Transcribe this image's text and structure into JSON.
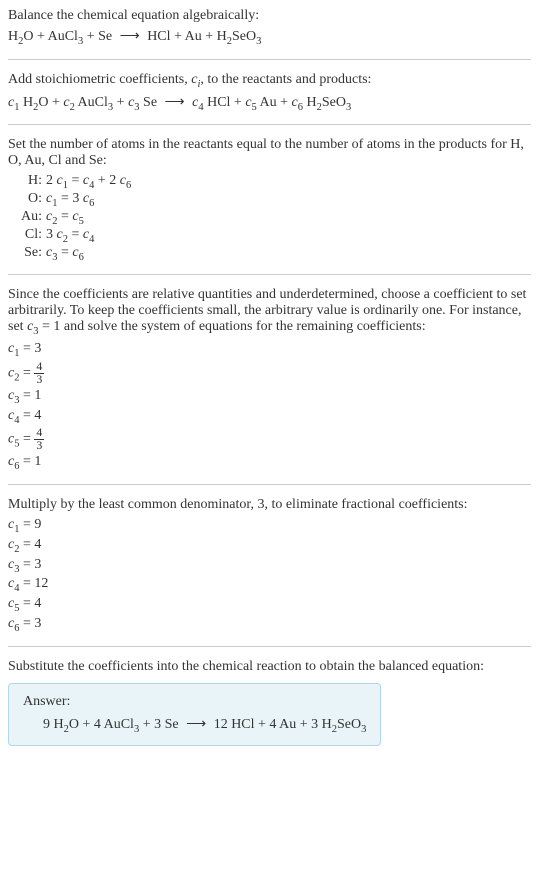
{
  "intro": {
    "line1": "Balance the chemical equation algebraically:",
    "equation_lhs": "H₂O + AuCl₃ + Se",
    "arrow": "⟶",
    "equation_rhs": "HCl + Au + H₂SeO₃"
  },
  "step2": {
    "text": "Add stoichiometric coefficients, cᵢ, to the reactants and products:",
    "equation": "c₁ H₂O + c₂ AuCl₃ + c₃ Se ⟶ c₄ HCl + c₅ Au + c₆ H₂SeO₃"
  },
  "step3": {
    "text": "Set the number of atoms in the reactants equal to the number of atoms in the products for H, O, Au, Cl and Se:",
    "rows": [
      {
        "label": "H:",
        "eq": "2 c₁ = c₄ + 2 c₆"
      },
      {
        "label": "O:",
        "eq": "c₁ = 3 c₆"
      },
      {
        "label": "Au:",
        "eq": "c₂ = c₅"
      },
      {
        "label": "Cl:",
        "eq": "3 c₂ = c₄"
      },
      {
        "label": "Se:",
        "eq": "c₃ = c₆"
      }
    ]
  },
  "step4": {
    "text": "Since the coefficients are relative quantities and underdetermined, choose a coefficient to set arbitrarily. To keep the coefficients small, the arbitrary value is ordinarily one. For instance, set c₃ = 1 and solve the system of equations for the remaining coefficients:",
    "coefs": [
      {
        "var": "c₁",
        "val": "3"
      },
      {
        "var": "c₂",
        "val_frac_num": "4",
        "val_frac_den": "3"
      },
      {
        "var": "c₃",
        "val": "1"
      },
      {
        "var": "c₄",
        "val": "4"
      },
      {
        "var": "c₅",
        "val_frac_num": "4",
        "val_frac_den": "3"
      },
      {
        "var": "c₆",
        "val": "1"
      }
    ]
  },
  "step5": {
    "text": "Multiply by the least common denominator, 3, to eliminate fractional coefficients:",
    "coefs": [
      {
        "var": "c₁",
        "val": "9"
      },
      {
        "var": "c₂",
        "val": "4"
      },
      {
        "var": "c₃",
        "val": "3"
      },
      {
        "var": "c₄",
        "val": "12"
      },
      {
        "var": "c₅",
        "val": "4"
      },
      {
        "var": "c₆",
        "val": "3"
      }
    ]
  },
  "step6": {
    "text": "Substitute the coefficients into the chemical reaction to obtain the balanced equation:"
  },
  "answer": {
    "label": "Answer:",
    "equation": "9 H₂O + 4 AuCl₃ + 3 Se ⟶ 12 HCl + 4 Au + 3 H₂SeO₃"
  },
  "chart_data": {
    "type": "table",
    "title": "Chemical equation balancing",
    "unbalanced_reactants": [
      "H2O",
      "AuCl3",
      "Se"
    ],
    "unbalanced_products": [
      "HCl",
      "Au",
      "H2SeO3"
    ],
    "element_equations": {
      "H": "2c1 = c4 + 2c6",
      "O": "c1 = 3c6",
      "Au": "c2 = c5",
      "Cl": "3c2 = c4",
      "Se": "c3 = c6"
    },
    "solution_c3_1": {
      "c1": 3,
      "c2": "4/3",
      "c3": 1,
      "c4": 4,
      "c5": "4/3",
      "c6": 1
    },
    "lcd": 3,
    "integer_solution": {
      "c1": 9,
      "c2": 4,
      "c3": 3,
      "c4": 12,
      "c5": 4,
      "c6": 3
    },
    "balanced": "9 H2O + 4 AuCl3 + 3 Se -> 12 HCl + 4 Au + 3 H2SeO3"
  }
}
